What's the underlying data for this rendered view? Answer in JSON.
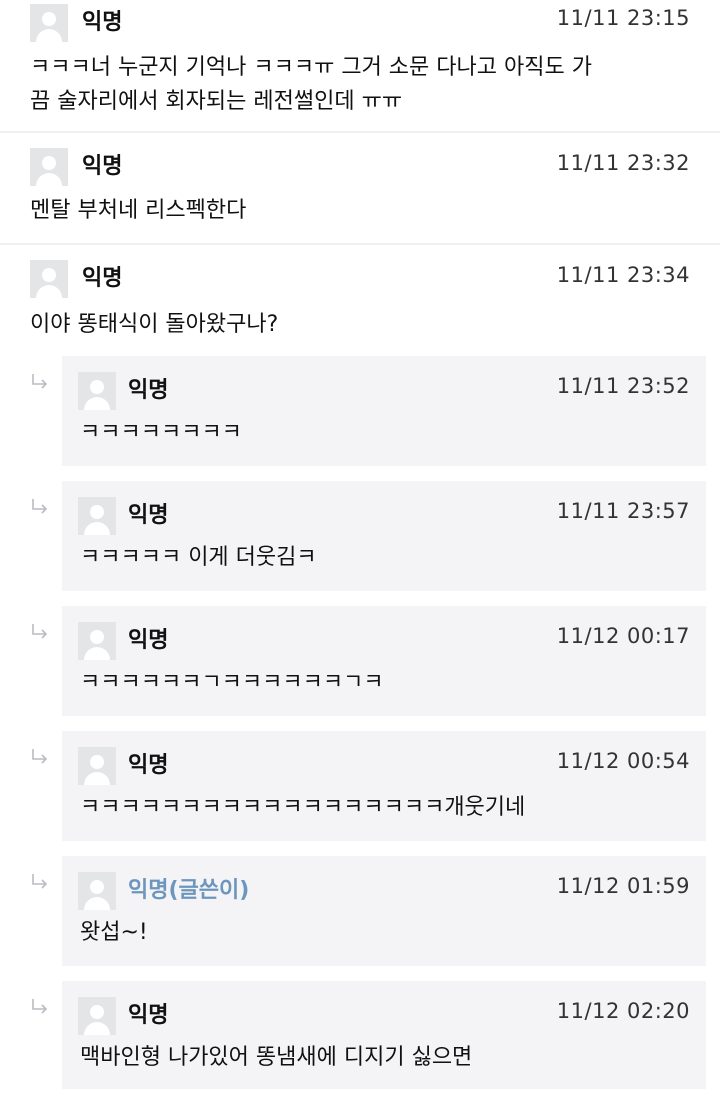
{
  "comments": [
    {
      "name": "익명",
      "time": "11/11 23:15",
      "text": "ㅋㅋㅋ너 누군지 기억나 ㅋㅋㅋㅠ 그거 소문 다나고 아직도 가\n끔 술자리에서 회자되는 레전썰인데 ㅠㅠ"
    },
    {
      "name": "익명",
      "time": "11/11 23:32",
      "text": "멘탈 부처네 리스펙한다"
    },
    {
      "name": "익명",
      "time": "11/11 23:34",
      "text": "이야 똥태식이 돌아왔구나?"
    }
  ],
  "replies": [
    {
      "name": "익명",
      "time": "11/11 23:52",
      "text": "ㅋㅋㅋㅋㅋㅋㅋㅋ"
    },
    {
      "name": "익명",
      "time": "11/11 23:57",
      "text": "ㅋㅋㅋㅋㅋ 이게 더웃김ㅋ"
    },
    {
      "name": "익명",
      "time": "11/12 00:17",
      "text": "ㅋㅋㅋㅋㅋㅋㄱㅋㅋㅋㅋㅋㅋㄱㅋ"
    },
    {
      "name": "익명",
      "time": "11/12 00:54",
      "text": "ㅋㅋㅋㅋㅋㅋㅋㅋㅋㅋㅋㅋㅋㅋㅋㅋㅋㅋ개웃기네"
    },
    {
      "name": "익명(글쓴이)",
      "time": "11/12 01:59",
      "text": "왓섭~!"
    },
    {
      "name": "익명",
      "time": "11/12 02:20",
      "text": "맥바인형 나가있어 똥냄새에 디지기 싫으면"
    }
  ]
}
